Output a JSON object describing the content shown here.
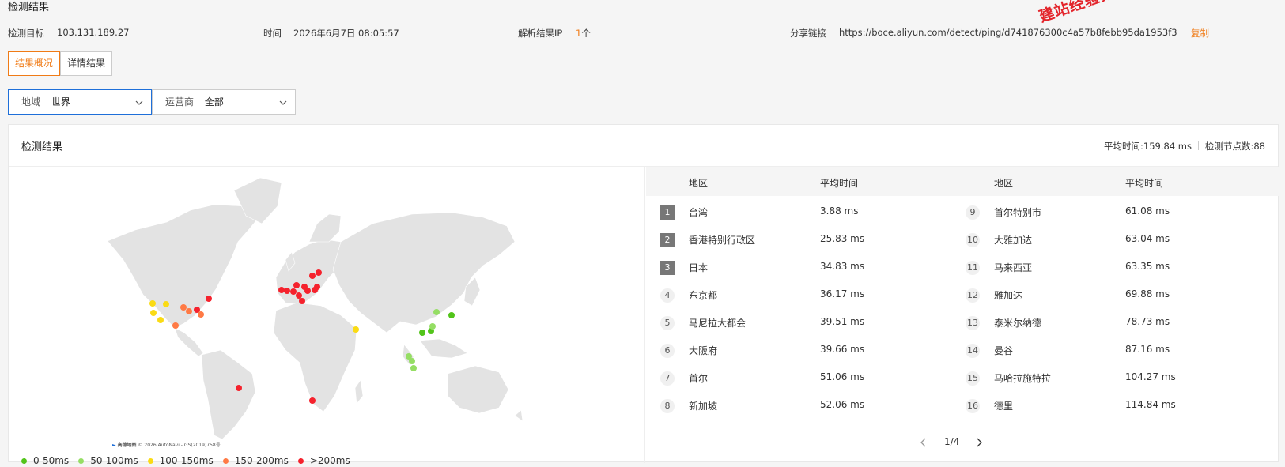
{
  "page_title": "检测结果",
  "info": {
    "target_label": "检测目标",
    "target_value": "103.131.189.27",
    "time_label": "时间",
    "time_value": "2026年6月7日 08:05:57",
    "ip_label": "解析结果IP",
    "ip_count": "1",
    "ip_unit": "个",
    "share_label": "分享链接",
    "share_url": "https://boce.aliyun.com/detect/ping/d741876300c4a57b8febb95da1953f3",
    "copy_label": "复制"
  },
  "watermark": "建站经验分享-www.w",
  "tabs": [
    {
      "label": "结果概况"
    },
    {
      "label": "详情结果"
    }
  ],
  "filters": {
    "region": {
      "label": "地域",
      "value": "世界"
    },
    "carrier": {
      "label": "运营商",
      "value": "全部"
    }
  },
  "panel": {
    "title": "检测结果",
    "avg_time": "平均时间:159.84 ms",
    "node_count": "检测节点数:88"
  },
  "map": {
    "credit_brand": "高德地图",
    "credit_text": "© 2026 AutoNavi - GS(2019)758号",
    "legend": [
      {
        "label": "0-50ms",
        "color": "#52c41a"
      },
      {
        "label": "50-100ms",
        "color": "#95de64"
      },
      {
        "label": "100-150ms",
        "color": "#fadb14"
      },
      {
        "label": "150-200ms",
        "color": "#ff7a45"
      },
      {
        "label": ">200ms",
        "color": "#f5222d"
      }
    ]
  },
  "table": {
    "headers": {
      "region": "地区",
      "avg": "平均时间"
    },
    "left": [
      {
        "rank": "1",
        "region": "台湾",
        "avg": "3.88 ms"
      },
      {
        "rank": "2",
        "region": "香港特别行政区",
        "avg": "25.83 ms"
      },
      {
        "rank": "3",
        "region": "日本",
        "avg": "34.83 ms"
      },
      {
        "rank": "4",
        "region": "东京都",
        "avg": "36.17 ms"
      },
      {
        "rank": "5",
        "region": "马尼拉大都会",
        "avg": "39.51 ms"
      },
      {
        "rank": "6",
        "region": "大阪府",
        "avg": "39.66 ms"
      },
      {
        "rank": "7",
        "region": "首尔",
        "avg": "51.06 ms"
      },
      {
        "rank": "8",
        "region": "新加坡",
        "avg": "52.06 ms"
      }
    ],
    "right": [
      {
        "rank": "9",
        "region": "首尔特别市",
        "avg": "61.08 ms"
      },
      {
        "rank": "10",
        "region": "大雅加达",
        "avg": "63.04 ms"
      },
      {
        "rank": "11",
        "region": "马来西亚",
        "avg": "63.35 ms"
      },
      {
        "rank": "12",
        "region": "雅加达",
        "avg": "69.88 ms"
      },
      {
        "rank": "13",
        "region": "泰米尔纳德",
        "avg": "78.73 ms"
      },
      {
        "rank": "14",
        "region": "曼谷",
        "avg": "87.16 ms"
      },
      {
        "rank": "15",
        "region": "马哈拉施特拉",
        "avg": "104.27 ms"
      },
      {
        "rank": "16",
        "region": "德里",
        "avg": "114.84 ms"
      }
    ],
    "pagination": "1/4"
  }
}
